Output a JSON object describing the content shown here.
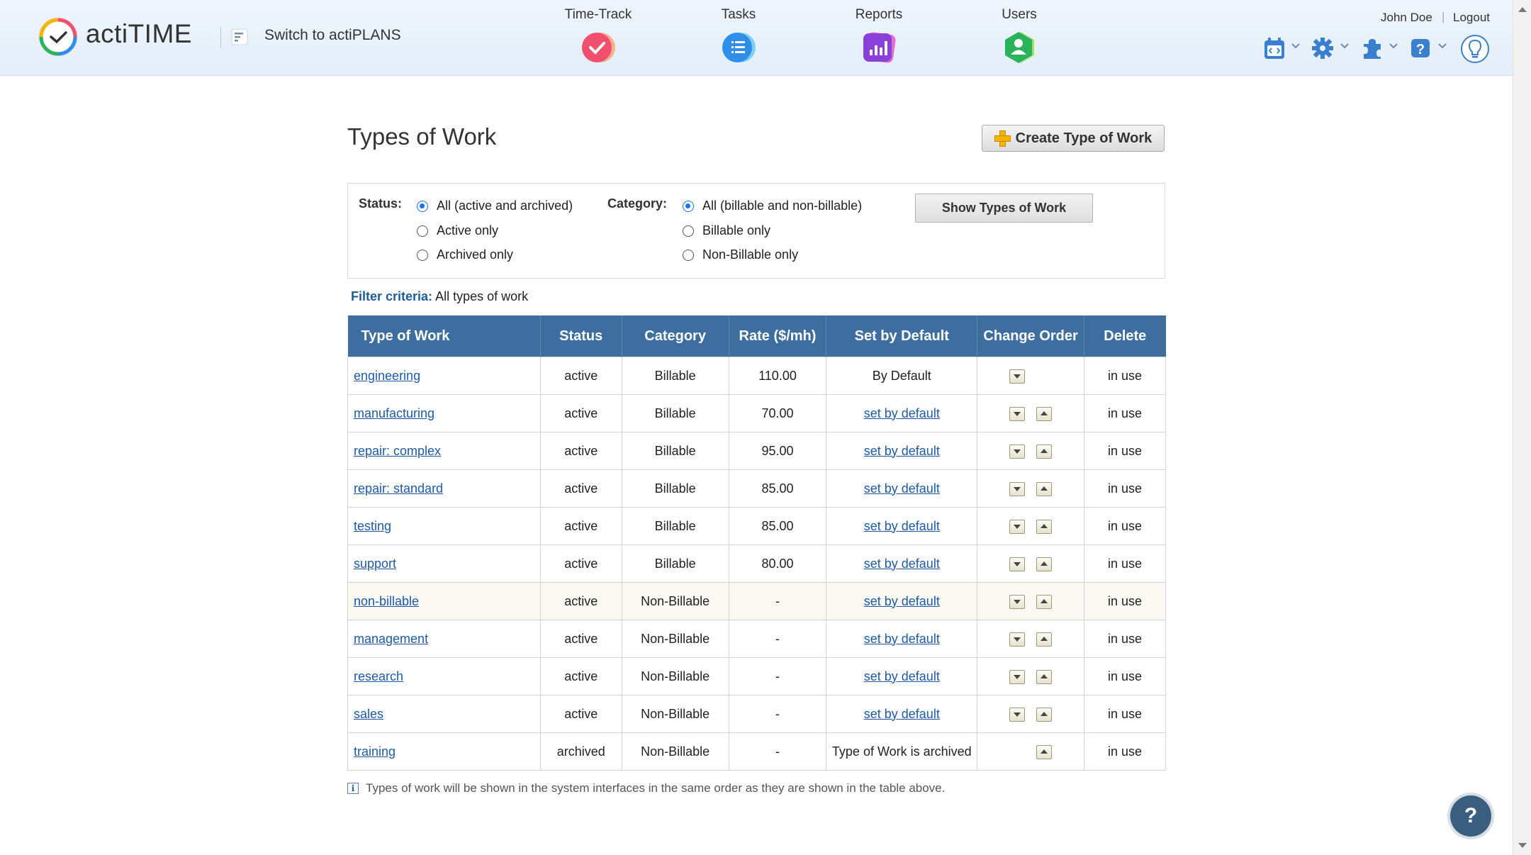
{
  "header": {
    "logo_text": "actiTIME",
    "switch_label": "Switch to actiPLANS",
    "nav": [
      {
        "label": "Time-Track",
        "icon": "time-track-icon",
        "color": "#f0506e"
      },
      {
        "label": "Tasks",
        "icon": "tasks-icon",
        "color": "#2f8fe8"
      },
      {
        "label": "Reports",
        "icon": "reports-icon",
        "color": "#8b3fd9"
      },
      {
        "label": "Users",
        "icon": "users-icon",
        "color": "#2bb35c"
      }
    ],
    "user_name": "John Doe",
    "separator": "|",
    "logout_label": "Logout"
  },
  "page": {
    "title": "Types of Work",
    "create_button": "Create Type of Work"
  },
  "filter": {
    "status_label": "Status:",
    "status_options": [
      "All (active and archived)",
      "Active only",
      "Archived only"
    ],
    "status_selected": 0,
    "category_label": "Category:",
    "category_options": [
      "All (billable and non-billable)",
      "Billable only",
      "Non-Billable only"
    ],
    "category_selected": 0,
    "show_button": "Show Types of Work",
    "criteria_label": "Filter criteria:",
    "criteria_value": "All types of work"
  },
  "table": {
    "columns": [
      "Type of Work",
      "Status",
      "Category",
      "Rate ($/mh)",
      "Set by Default",
      "Change Order",
      "Delete"
    ],
    "rows": [
      {
        "name": "engineering",
        "status": "active",
        "category": "Billable",
        "rate": "110.00",
        "default": "By Default",
        "down": true,
        "up": false,
        "delete": "in use"
      },
      {
        "name": "manufacturing",
        "status": "active",
        "category": "Billable",
        "rate": "70.00",
        "default": "set by default",
        "down": true,
        "up": true,
        "delete": "in use"
      },
      {
        "name": "repair: complex",
        "status": "active",
        "category": "Billable",
        "rate": "95.00",
        "default": "set by default",
        "down": true,
        "up": true,
        "delete": "in use"
      },
      {
        "name": "repair: standard",
        "status": "active",
        "category": "Billable",
        "rate": "85.00",
        "default": "set by default",
        "down": true,
        "up": true,
        "delete": "in use"
      },
      {
        "name": "testing",
        "status": "active",
        "category": "Billable",
        "rate": "85.00",
        "default": "set by default",
        "down": true,
        "up": true,
        "delete": "in use"
      },
      {
        "name": "support",
        "status": "active",
        "category": "Billable",
        "rate": "80.00",
        "default": "set by default",
        "down": true,
        "up": true,
        "delete": "in use"
      },
      {
        "name": "non-billable",
        "status": "active",
        "category": "Non-Billable",
        "rate": "-",
        "default": "set by default",
        "down": true,
        "up": true,
        "delete": "in use",
        "muted": true
      },
      {
        "name": "management",
        "status": "active",
        "category": "Non-Billable",
        "rate": "-",
        "default": "set by default",
        "down": true,
        "up": true,
        "delete": "in use"
      },
      {
        "name": "research",
        "status": "active",
        "category": "Non-Billable",
        "rate": "-",
        "default": "set by default",
        "down": true,
        "up": true,
        "delete": "in use"
      },
      {
        "name": "sales",
        "status": "active",
        "category": "Non-Billable",
        "rate": "-",
        "default": "set by default",
        "down": true,
        "up": true,
        "delete": "in use"
      },
      {
        "name": "training",
        "status": "archived",
        "category": "Non-Billable",
        "rate": "-",
        "default": "Type of Work is archived",
        "down": false,
        "up": true,
        "delete": "in use"
      }
    ]
  },
  "note": "Types of work will be shown in the system interfaces in the same order as they are shown in the table above.",
  "colors": {
    "header_bg": "#e6f0fb",
    "table_header": "#3e6e9f",
    "active": "#2e9a2e",
    "archived": "#d42020",
    "link": "#1e5aa5"
  }
}
